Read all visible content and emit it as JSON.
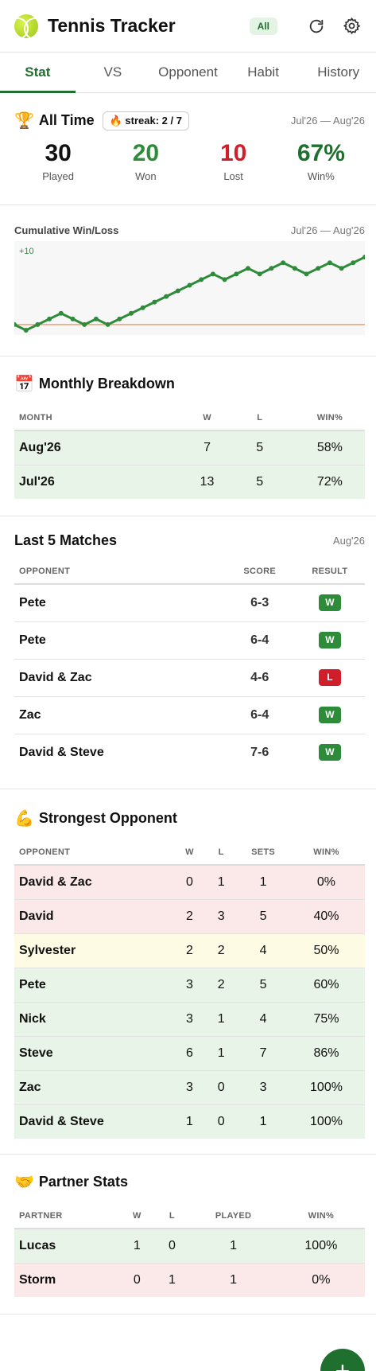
{
  "header": {
    "title": "Tennis Tracker",
    "filter_chip": "All",
    "icons": [
      "tennis-ball-icon",
      "refresh-icon",
      "gear-icon"
    ]
  },
  "tabs": [
    {
      "label": "Stat"
    },
    {
      "label": "VS"
    },
    {
      "label": "Opponent"
    },
    {
      "label": "Habit"
    },
    {
      "label": "History"
    }
  ],
  "all_time": {
    "title": "All Time",
    "emoji": "🏆",
    "streak": "🔥 streak: 2 / 7",
    "range": "Jul'26 — Aug'26",
    "played": {
      "value": "30",
      "label": "Played"
    },
    "won": {
      "value": "20",
      "label": "Won"
    },
    "lost": {
      "value": "10",
      "label": "Lost"
    },
    "winpct": {
      "value": "67%",
      "label": "Win%"
    }
  },
  "cumulative": {
    "title": "Cumulative Win/Loss",
    "range": "Jul'26 — Aug'26",
    "top_label": "+10"
  },
  "chart_data": {
    "type": "line",
    "series": [
      {
        "values": [
          0,
          -1,
          0,
          1,
          2,
          1,
          0,
          1,
          0,
          1,
          2,
          3,
          4,
          5,
          6,
          7,
          8,
          9,
          8,
          9,
          10,
          9,
          10,
          11,
          10,
          9,
          10,
          11,
          10,
          11,
          12
        ]
      }
    ],
    "ylim": [
      -1,
      14
    ],
    "colors": {
      "line": "#2e8b3a",
      "zero_line": "#f0a070"
    }
  },
  "monthly": {
    "title": "Monthly Breakdown",
    "emoji": "📅",
    "headers": [
      "MONTH",
      "W",
      "L",
      "WIN%"
    ],
    "rows": [
      [
        "Aug'26",
        "7",
        "5",
        "58%"
      ],
      [
        "Jul'26",
        "13",
        "5",
        "72%"
      ]
    ]
  },
  "last5": {
    "title": "Last 5 Matches",
    "range": "Aug'26",
    "headers": [
      "OPPONENT",
      "SCORE",
      "RESULT"
    ],
    "rows": [
      [
        "Pete",
        "6-3",
        "W"
      ],
      [
        "Pete",
        "6-4",
        "W"
      ],
      [
        "David & Zac",
        "4-6",
        "L"
      ],
      [
        "Zac",
        "6-4",
        "W"
      ],
      [
        "David & Steve",
        "7-6",
        "W"
      ]
    ]
  },
  "strongest": {
    "title": "Strongest Opponent",
    "emoji": "💪",
    "headers": [
      "OPPONENT",
      "W",
      "L",
      "SETS",
      "WIN%"
    ],
    "rows": [
      [
        "David & Zac",
        "0",
        "1",
        "1",
        "0%"
      ],
      [
        "David",
        "2",
        "3",
        "5",
        "40%"
      ],
      [
        "Sylvester",
        "2",
        "2",
        "4",
        "50%"
      ],
      [
        "Pete",
        "3",
        "2",
        "5",
        "60%"
      ],
      [
        "Nick",
        "3",
        "1",
        "4",
        "75%"
      ],
      [
        "Steve",
        "6",
        "1",
        "7",
        "86%"
      ],
      [
        "Zac",
        "3",
        "0",
        "3",
        "100%"
      ],
      [
        "David & Steve",
        "1",
        "0",
        "1",
        "100%"
      ]
    ]
  },
  "partners": {
    "title": "Partner Stats",
    "emoji": "🤝",
    "headers": [
      "PARTNER",
      "W",
      "L",
      "PLAYED",
      "WIN%"
    ],
    "rows": [
      [
        "Lucas",
        "1",
        "0",
        "1",
        "100%"
      ],
      [
        "Storm",
        "0",
        "1",
        "1",
        "0%"
      ]
    ]
  },
  "fab": {
    "label": "+"
  },
  "colors": {
    "won": "#2e8b3a",
    "lost": "#d01e2a",
    "accent": "#1f6f2e"
  }
}
